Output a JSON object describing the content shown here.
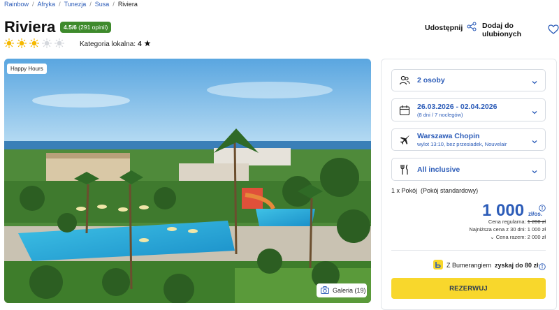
{
  "breadcrumb": {
    "items": [
      "Rainbow",
      "Afryka",
      "Tunezja",
      "Susa"
    ],
    "current": "Riviera",
    "separator": "/"
  },
  "hotel": {
    "name": "Riviera",
    "rating_score": "4.5/6",
    "rating_count": "(291 opinii)",
    "suns_filled": 3,
    "suns_total": 5,
    "local_category_label": "Kategoria lokalna:",
    "local_category_value": "4"
  },
  "actions": {
    "share_label": "Udostępnij",
    "favorite_label": "Dodaj do ulubionych"
  },
  "photo": {
    "badge": "Happy Hours",
    "gallery_label": "Galeria (19)"
  },
  "booking": {
    "persons": "2 osoby",
    "dates": "26.03.2026 - 02.04.2026",
    "dates_sub": "(8 dni / 7 noclegów)",
    "airport": "Warszawa Chopin",
    "airport_sub": "wylot 13:10, bez przesiadek, Nouvelair",
    "board": "All inclusive",
    "room_qty": "1 x Pokój",
    "room_type": "(Pokój standardowy)",
    "price": "1 000",
    "price_unit": "zł/os.",
    "regular_label": "Cena regularna:",
    "regular_value": "1 200 zł",
    "lowest_label": "Najniższa cena z 30 dni:",
    "lowest_value": "1 000 zł",
    "total_label": "Cena razem:",
    "total_value": "2 000 zł",
    "boomerang_prefix": "Z Bumerangiem",
    "boomerang_bold": "zyskaj do 80 zł",
    "reserve_label": "REZERWUJ"
  },
  "colors": {
    "brand_blue": "#2c5cb8",
    "rating_green": "#3e8a2c",
    "reserve_yellow": "#f8d72c",
    "sun_yellow": "#f5b800"
  }
}
